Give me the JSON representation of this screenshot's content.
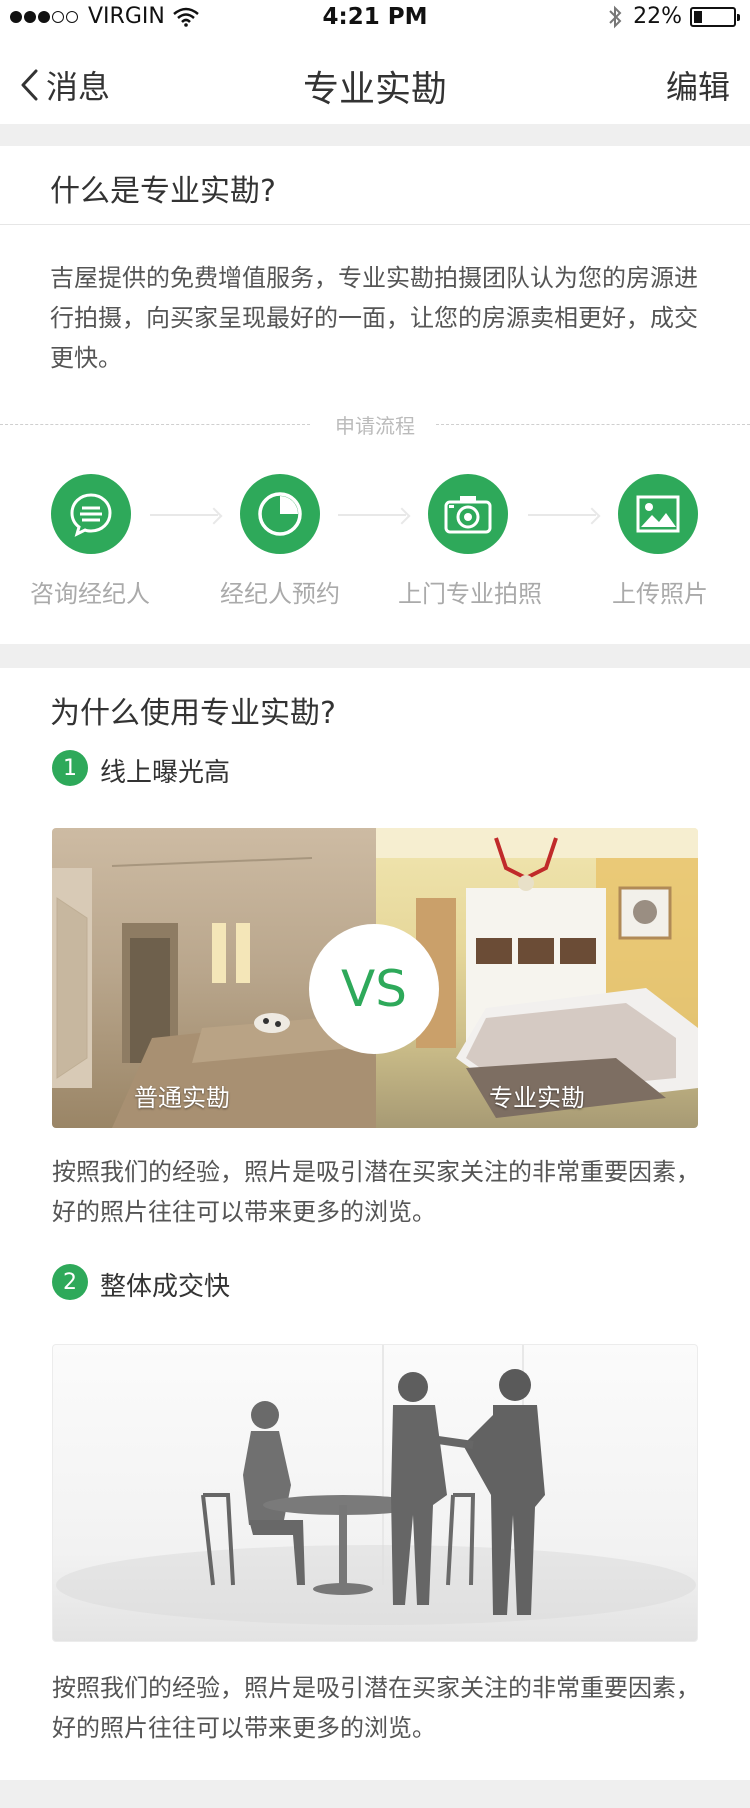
{
  "status_bar": {
    "carrier": "VIRGIN",
    "time": "4:21 PM",
    "battery": "22%",
    "battery_level": 0.22
  },
  "nav": {
    "back_label": "消息",
    "title": "专业实勘",
    "edit_label": "编辑"
  },
  "what": {
    "title": "什么是专业实勘?",
    "description": "吉屋提供的免费增值服务，专业实勘拍摄团队认为您的房源进行拍摄，向买家呈现最好的一面，让您的房源卖相更好，成交更快。",
    "flow_title": "申请流程",
    "steps": [
      {
        "label": "咨询经纪人",
        "icon": "chat-icon"
      },
      {
        "label": "经纪人预约",
        "icon": "clock-icon"
      },
      {
        "label": "上门专业拍照",
        "icon": "camera-icon"
      },
      {
        "label": "上传照片",
        "icon": "image-icon"
      }
    ]
  },
  "why": {
    "title": "为什么使用专业实勘?",
    "items": [
      {
        "num": "1",
        "title": "线上曝光高",
        "compare": {
          "left": "普通实勘",
          "vs": "VS",
          "right": "专业实勘"
        },
        "text": "按照我们的经验，照片是吸引潜在买家关注的非常重要因素，好的照片往往可以带来更多的浏览。"
      },
      {
        "num": "2",
        "title": "整体成交快",
        "text": "按照我们的经验，照片是吸引潜在买家关注的非常重要因素，好的照片往往可以带来更多的浏览。"
      }
    ]
  },
  "colors": {
    "accent": "#2ea95a",
    "background": "#efefef"
  }
}
